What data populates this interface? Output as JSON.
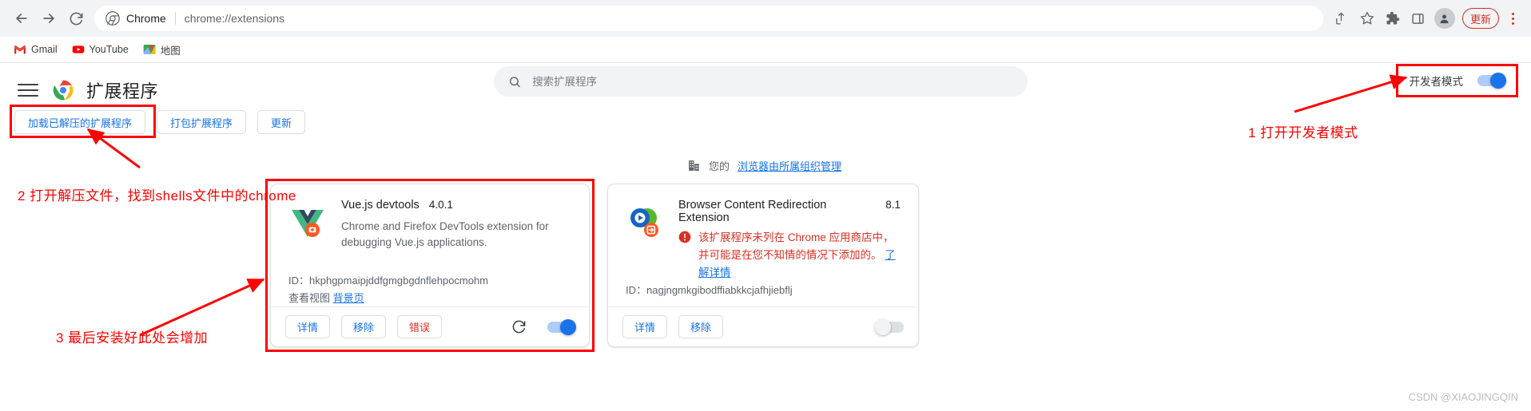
{
  "browser": {
    "nav": {
      "back": "back-arrow",
      "forward": "forward-arrow",
      "reload": "reload"
    },
    "omnibox": {
      "site_label": "Chrome",
      "url": "chrome://extensions"
    },
    "toolbar_icons": [
      "share-icon",
      "bookmark-star-icon",
      "extensions-puzzle-icon",
      "side-panel-icon",
      "profile-avatar-icon"
    ],
    "update_button": "更新",
    "menu": "three-dot-menu"
  },
  "bookmarks": [
    {
      "label": "Gmail",
      "icon": "gmail-icon"
    },
    {
      "label": "YouTube",
      "icon": "youtube-icon"
    },
    {
      "label": "地图",
      "icon": "maps-icon"
    }
  ],
  "page": {
    "title": "扩展程序",
    "menu_icon": "hamburger-menu-icon",
    "logo": "chrome-logo",
    "search": {
      "placeholder": "搜索扩展程序",
      "value": ""
    },
    "dev_mode": {
      "label": "开发者模式",
      "enabled": true
    },
    "buttons": [
      {
        "label": "加载已解压的扩展程序",
        "highlighted": true
      },
      {
        "label": "打包扩展程序",
        "highlighted": false
      },
      {
        "label": "更新",
        "highlighted": false
      }
    ],
    "managed_notice": {
      "prefix": "您的",
      "link": "浏览器由所属组织管理",
      "icon": "enterprise-building-icon"
    }
  },
  "extensions": [
    {
      "id_key": "vue",
      "name": "Vue.js devtools",
      "version": "4.0.1",
      "description": "Chrome and Firefox DevTools extension for debugging Vue.js applications.",
      "id_label": "ID：",
      "id_value": "hkphgpmaipjddfgmgbgdnflehpocmohm",
      "views_label": "查看视图",
      "views_link": "背景页",
      "icon": "vue-logo-icon",
      "buttons": [
        {
          "label": "详情",
          "style": "link"
        },
        {
          "label": "移除",
          "style": "link"
        },
        {
          "label": "错误",
          "style": "error"
        }
      ],
      "reload_icon": "reload-icon",
      "enabled": true,
      "highlighted": true
    },
    {
      "id_key": "bcre",
      "name": "Browser Content Redirection Extension",
      "version": "8.1",
      "warning_icon": "error-circle-icon",
      "warning_text": "该扩展程序未列在 Chrome 应用商店中，并可能是在您不知情的情况下添加的。",
      "warning_link": "了解详情",
      "id_label": "ID：",
      "id_value": "nagjngmkgibodffiabkkcjafhjiebflj",
      "icon": "citrix-redirection-icon",
      "buttons": [
        {
          "label": "详情",
          "style": "link"
        },
        {
          "label": "移除",
          "style": "link"
        }
      ],
      "enabled": false,
      "highlighted": false
    }
  ],
  "annotations": [
    {
      "key": "a1",
      "text": "1 打开开发者模式"
    },
    {
      "key": "a2",
      "text": "2 打开解压文件，找到shells文件中的chrome"
    },
    {
      "key": "a3",
      "text": "3 最后安装好此处会增加"
    }
  ],
  "watermark": "CSDN @XIAOJINGQIN",
  "colors": {
    "annotation_red": "#ff0000",
    "chrome_blue": "#1a73e8",
    "error_red": "#d93025",
    "toolbar_bg": "#f1f3f4"
  }
}
